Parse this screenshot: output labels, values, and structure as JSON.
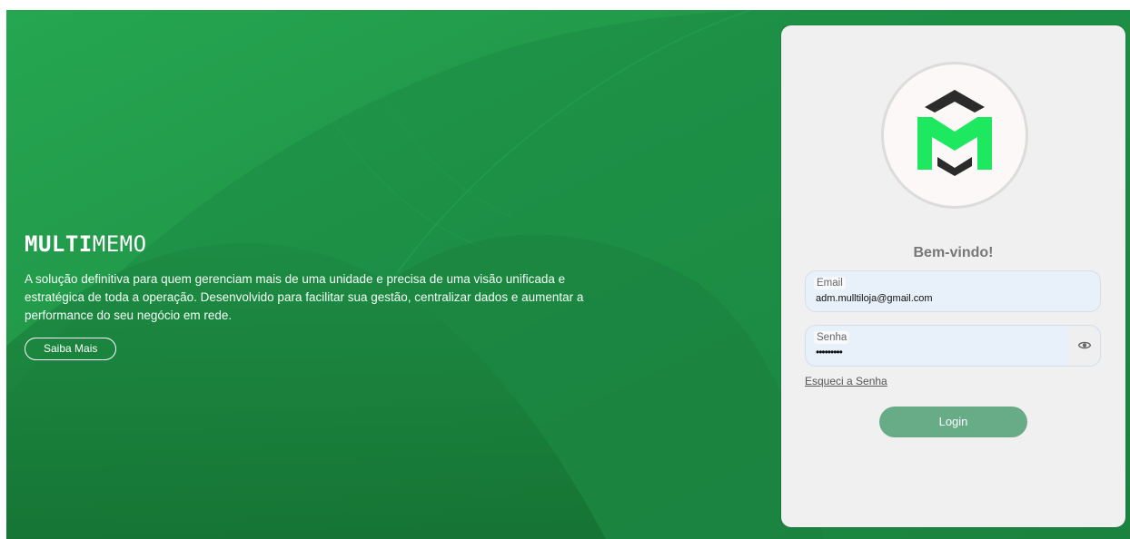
{
  "hero": {
    "brand_bold": "MULTI",
    "brand_light": "MEMO",
    "tagline": "A solução definitiva para quem gerenciam mais de uma unidade e precisa de uma visão unificada e estratégica de toda a operação. Desenvolvido para facilitar sua gestão, centralizar dados e aumentar a performance do seu negócio em rede.",
    "more_button": "Saiba Mais"
  },
  "login": {
    "welcome": "Bem-vindo!",
    "email_label": "Email",
    "email_value": "adm.mulltiloja@gmail.com",
    "password_label": "Senha",
    "password_value": "•••••••••",
    "forgot_link": "Esqueci a Senha",
    "login_button": "Login",
    "password_toggle_icon": "eye-icon",
    "logo_icon": "multimemo-logo-icon"
  },
  "colors": {
    "background_green": "#1e7f3f",
    "light_green": "#23a04e",
    "logo_green": "#1ee860",
    "logo_dark": "#2b2b2b",
    "login_button": "#67ab87",
    "card": "#f0f0f0"
  }
}
